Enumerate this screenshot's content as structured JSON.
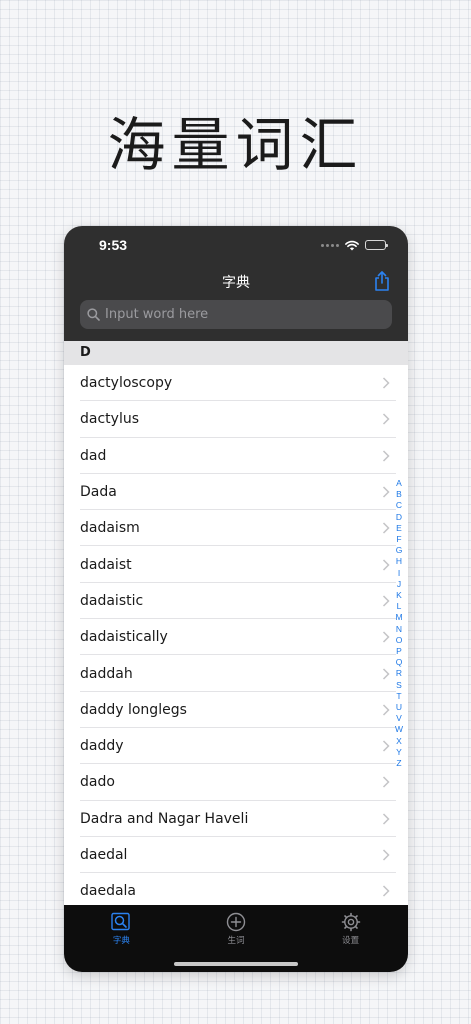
{
  "headline": "海量词汇",
  "status": {
    "time": "9:53"
  },
  "nav": {
    "title": "字典"
  },
  "search": {
    "placeholder": "Input word here",
    "value": ""
  },
  "section": {
    "letter": "D"
  },
  "words": [
    "dactyloscopy",
    "dactylus",
    "dad",
    "Dada",
    "dadaism",
    "dadaist",
    "dadaistic",
    "dadaistically",
    "daddah",
    "daddy longlegs",
    "daddy",
    "dado",
    "Dadra and Nagar Haveli",
    "daedal",
    "daedala"
  ],
  "index_letters": [
    "A",
    "B",
    "C",
    "D",
    "E",
    "F",
    "G",
    "H",
    "I",
    "J",
    "K",
    "L",
    "M",
    "N",
    "O",
    "P",
    "Q",
    "R",
    "S",
    "T",
    "U",
    "V",
    "W",
    "X",
    "Y",
    "Z"
  ],
  "tabs": [
    {
      "label": "字典",
      "icon": "dictionary-icon",
      "active": true
    },
    {
      "label": "生词",
      "icon": "plus-circle-icon",
      "active": false
    },
    {
      "label": "设置",
      "icon": "gear-icon",
      "active": false
    }
  ],
  "colors": {
    "accent": "#2b82f0",
    "index_letter": "#1e78e6",
    "topbar": "#2f2f2f",
    "tabbar": "#0d0d0d"
  }
}
